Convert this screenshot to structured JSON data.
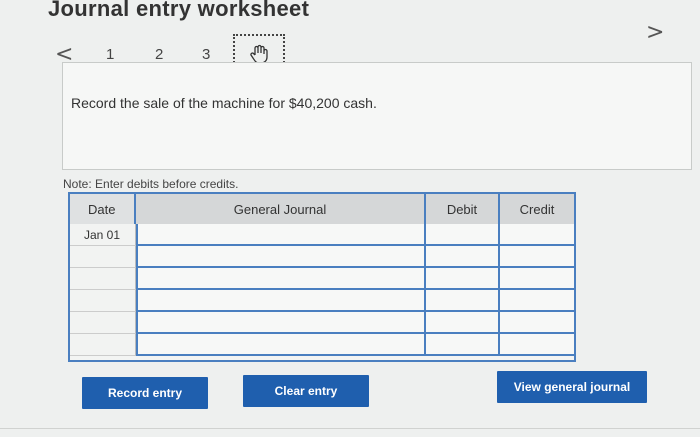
{
  "title": "Journal entry worksheet",
  "nav": {
    "prev": "<",
    "next": ">",
    "pages": [
      "1",
      "2",
      "3"
    ]
  },
  "prompt": "Record the sale of the machine for $40,200 cash.",
  "note": "Note: Enter debits before credits.",
  "journal": {
    "headers": {
      "date": "Date",
      "account": "General Journal",
      "debit": "Debit",
      "credit": "Credit"
    },
    "rows": [
      {
        "date": "Jan 01",
        "account": "",
        "debit": "",
        "credit": ""
      },
      {
        "date": "",
        "account": "",
        "debit": "",
        "credit": ""
      },
      {
        "date": "",
        "account": "",
        "debit": "",
        "credit": ""
      },
      {
        "date": "",
        "account": "",
        "debit": "",
        "credit": ""
      },
      {
        "date": "",
        "account": "",
        "debit": "",
        "credit": ""
      },
      {
        "date": "",
        "account": "",
        "debit": "",
        "credit": ""
      }
    ]
  },
  "buttons": {
    "record": "Record entry",
    "clear": "Clear entry",
    "view": "View general journal"
  },
  "icons": {
    "page4": "hand-pointer-icon"
  },
  "colors": {
    "accent": "#1f5fae",
    "grid": "#4a7fc0"
  }
}
